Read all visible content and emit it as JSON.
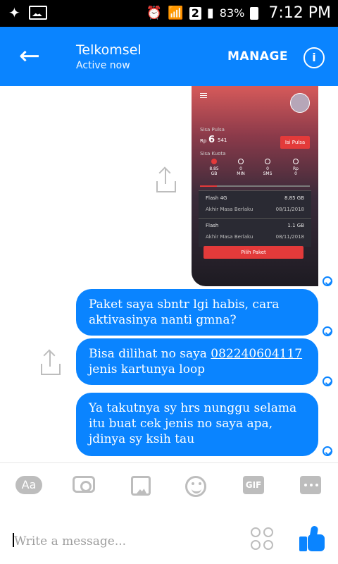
{
  "status_bar": {
    "battery": "83%",
    "time": "7:12 PM",
    "sim": "2"
  },
  "header": {
    "title": "Telkomsel",
    "subtitle": "Active now",
    "manage_label": "MANAGE"
  },
  "screenshot": {
    "label_pulsa": "Sisa Pulsa",
    "amount_prefix": "Rp",
    "amount_main": "6",
    "amount_rest": "541",
    "btn_isi_pulsa": "Isi Pulsa",
    "label_kuota": "Sisa Kuota",
    "kuota_stats": [
      {
        "value": "8.85",
        "unit": "GB"
      },
      {
        "value": "0",
        "unit": "MIN"
      },
      {
        "value": "0",
        "unit": "SMS"
      },
      {
        "value": "Rp",
        "unit": "0"
      }
    ],
    "card1": {
      "title": "Flash 4G",
      "value": "8.85 GB",
      "label2": "Akhir Masa Berlaku",
      "date": "08/11/2018"
    },
    "card2": {
      "title": "Flash",
      "value": "1.1 GB",
      "label2": "Akhir Masa Berlaku",
      "date": "08/11/2018"
    },
    "btn_pilih": "Pilih Paket"
  },
  "messages": [
    {
      "text": "Paket saya sbntr lgi habis, cara aktivasinya nanti gmna?"
    },
    {
      "text_before": "Bisa dilihat no saya ",
      "link": "082240604117",
      "text_after": " jenis kartunya loop"
    },
    {
      "text": "Ya takutnya sy hrs nunggu selama itu buat cek jenis no saya apa, jdinya sy ksih tau"
    }
  ],
  "toolbar": {
    "aa_label": "Aa",
    "gif_label": "GIF"
  },
  "composer": {
    "placeholder": "Write a message..."
  },
  "colors": {
    "accent": "#0a84ff",
    "muted_icon": "#bdbdbd",
    "status_bar_bg": "#000000"
  }
}
